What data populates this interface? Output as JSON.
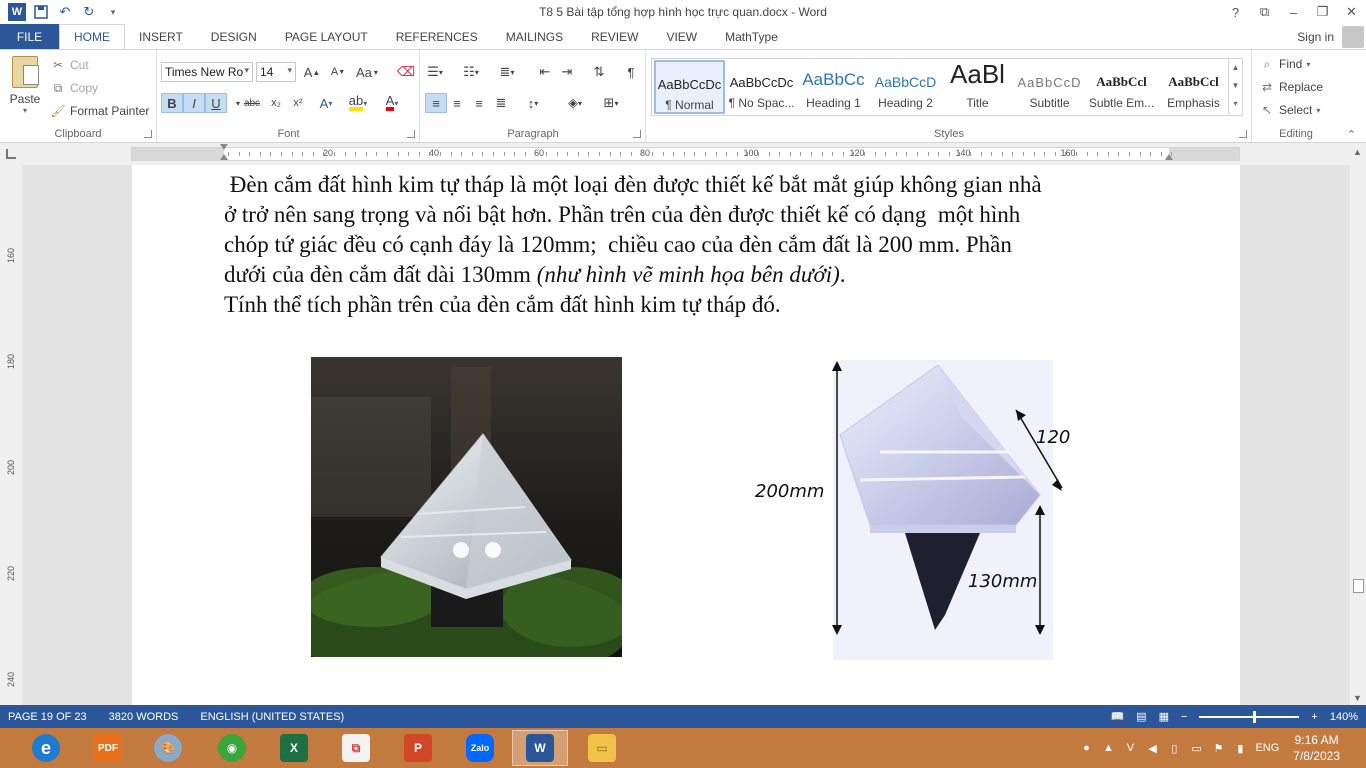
{
  "titlebar": {
    "title": "T8 5 Bài tập tổng hợp hình học trực quan.docx - Word",
    "help_icon": "?",
    "quick_access": [
      "save-icon",
      "undo-icon",
      "redo-icon",
      "customize-icon"
    ]
  },
  "tabs": [
    "FILE",
    "HOME",
    "INSERT",
    "DESIGN",
    "PAGE LAYOUT",
    "REFERENCES",
    "MAILINGS",
    "REVIEW",
    "VIEW",
    "MathType"
  ],
  "active_tab": "HOME",
  "signin": "Sign in",
  "clipboard": {
    "paste": "Paste",
    "cut": "Cut",
    "copy": "Copy",
    "format_painter": "Format Painter",
    "label": "Clipboard"
  },
  "font": {
    "family": "Times New Ro",
    "size": "14",
    "bold": "B",
    "italic": "I",
    "underline": "U",
    "strike": "abc",
    "subscript": "x₂",
    "superscript": "x²",
    "grow": "A",
    "shrink": "A",
    "change_case": "Aa",
    "label": "Font"
  },
  "paragraph": {
    "label": "Paragraph"
  },
  "styles": {
    "items": [
      {
        "sample": "AaBbCcDc",
        "name": "¶ Normal"
      },
      {
        "sample": "AaBbCcDc",
        "name": "¶ No Spac..."
      },
      {
        "sample": "AaBbCc",
        "name": "Heading 1"
      },
      {
        "sample": "AaBbCcD",
        "name": "Heading 2"
      },
      {
        "sample": "AaBl",
        "name": "Title"
      },
      {
        "sample": "AaBbCcD",
        "name": "Subtitle"
      },
      {
        "sample": "AaBbCcl",
        "name": "Subtle Em..."
      },
      {
        "sample": "AaBbCcl",
        "name": "Emphasis"
      }
    ],
    "label": "Styles"
  },
  "editing": {
    "find": "Find",
    "replace": "Replace",
    "select": "Select",
    "label": "Editing"
  },
  "ruler": {
    "numbers": [
      "20",
      "40",
      "60",
      "80",
      "100",
      "120",
      "140",
      "160"
    ],
    "vertical_numbers": [
      "160",
      "180",
      "200",
      "220",
      "240"
    ]
  },
  "document": {
    "line1": " Đèn cắm đất hình kim tự tháp là một loại đèn được thiết kế bắt mắt giúp không gian nhà",
    "line2": "ở trở nên sang trọng và nổi bật hơn. Phần trên của đèn được thiết kế có dạng  một hình",
    "line3": "chóp tứ giác đều có cạnh đáy là 120mm;  chiều cao của đèn cắm đất là 200 mm. Phần",
    "line4_normal": "dưới của đèn cắm đất dài 130mm ",
    "line4_italic": "(như hình vẽ minh họa bên dưới)",
    "line4_end": ".",
    "line5": "Tính thể tích phần trên của đèn cắm đất hình kim tự tháp đó.",
    "diagram": {
      "label_height": "200mm",
      "label_edge": "120mm",
      "label_stake": "130mm"
    }
  },
  "status": {
    "page": "PAGE 19 OF 23",
    "words": "3820 WORDS",
    "language": "ENGLISH (UNITED STATES)",
    "zoom": "140%"
  },
  "taskbar": {
    "apps": [
      "ie-icon",
      "pdf-icon",
      "paint-icon",
      "coccoc-icon",
      "excel-icon",
      "publisher-icon",
      "powerpoint-icon",
      "zalo-icon",
      "word-icon",
      "explorer-icon"
    ],
    "zalo_label": "Zalo",
    "pdf_label": "PDF",
    "lang": "ENG",
    "time": "9:16 AM",
    "date": "7/8/2023"
  },
  "colors": {
    "accent": "#2b579a",
    "taskbar": "#c27a3e"
  }
}
